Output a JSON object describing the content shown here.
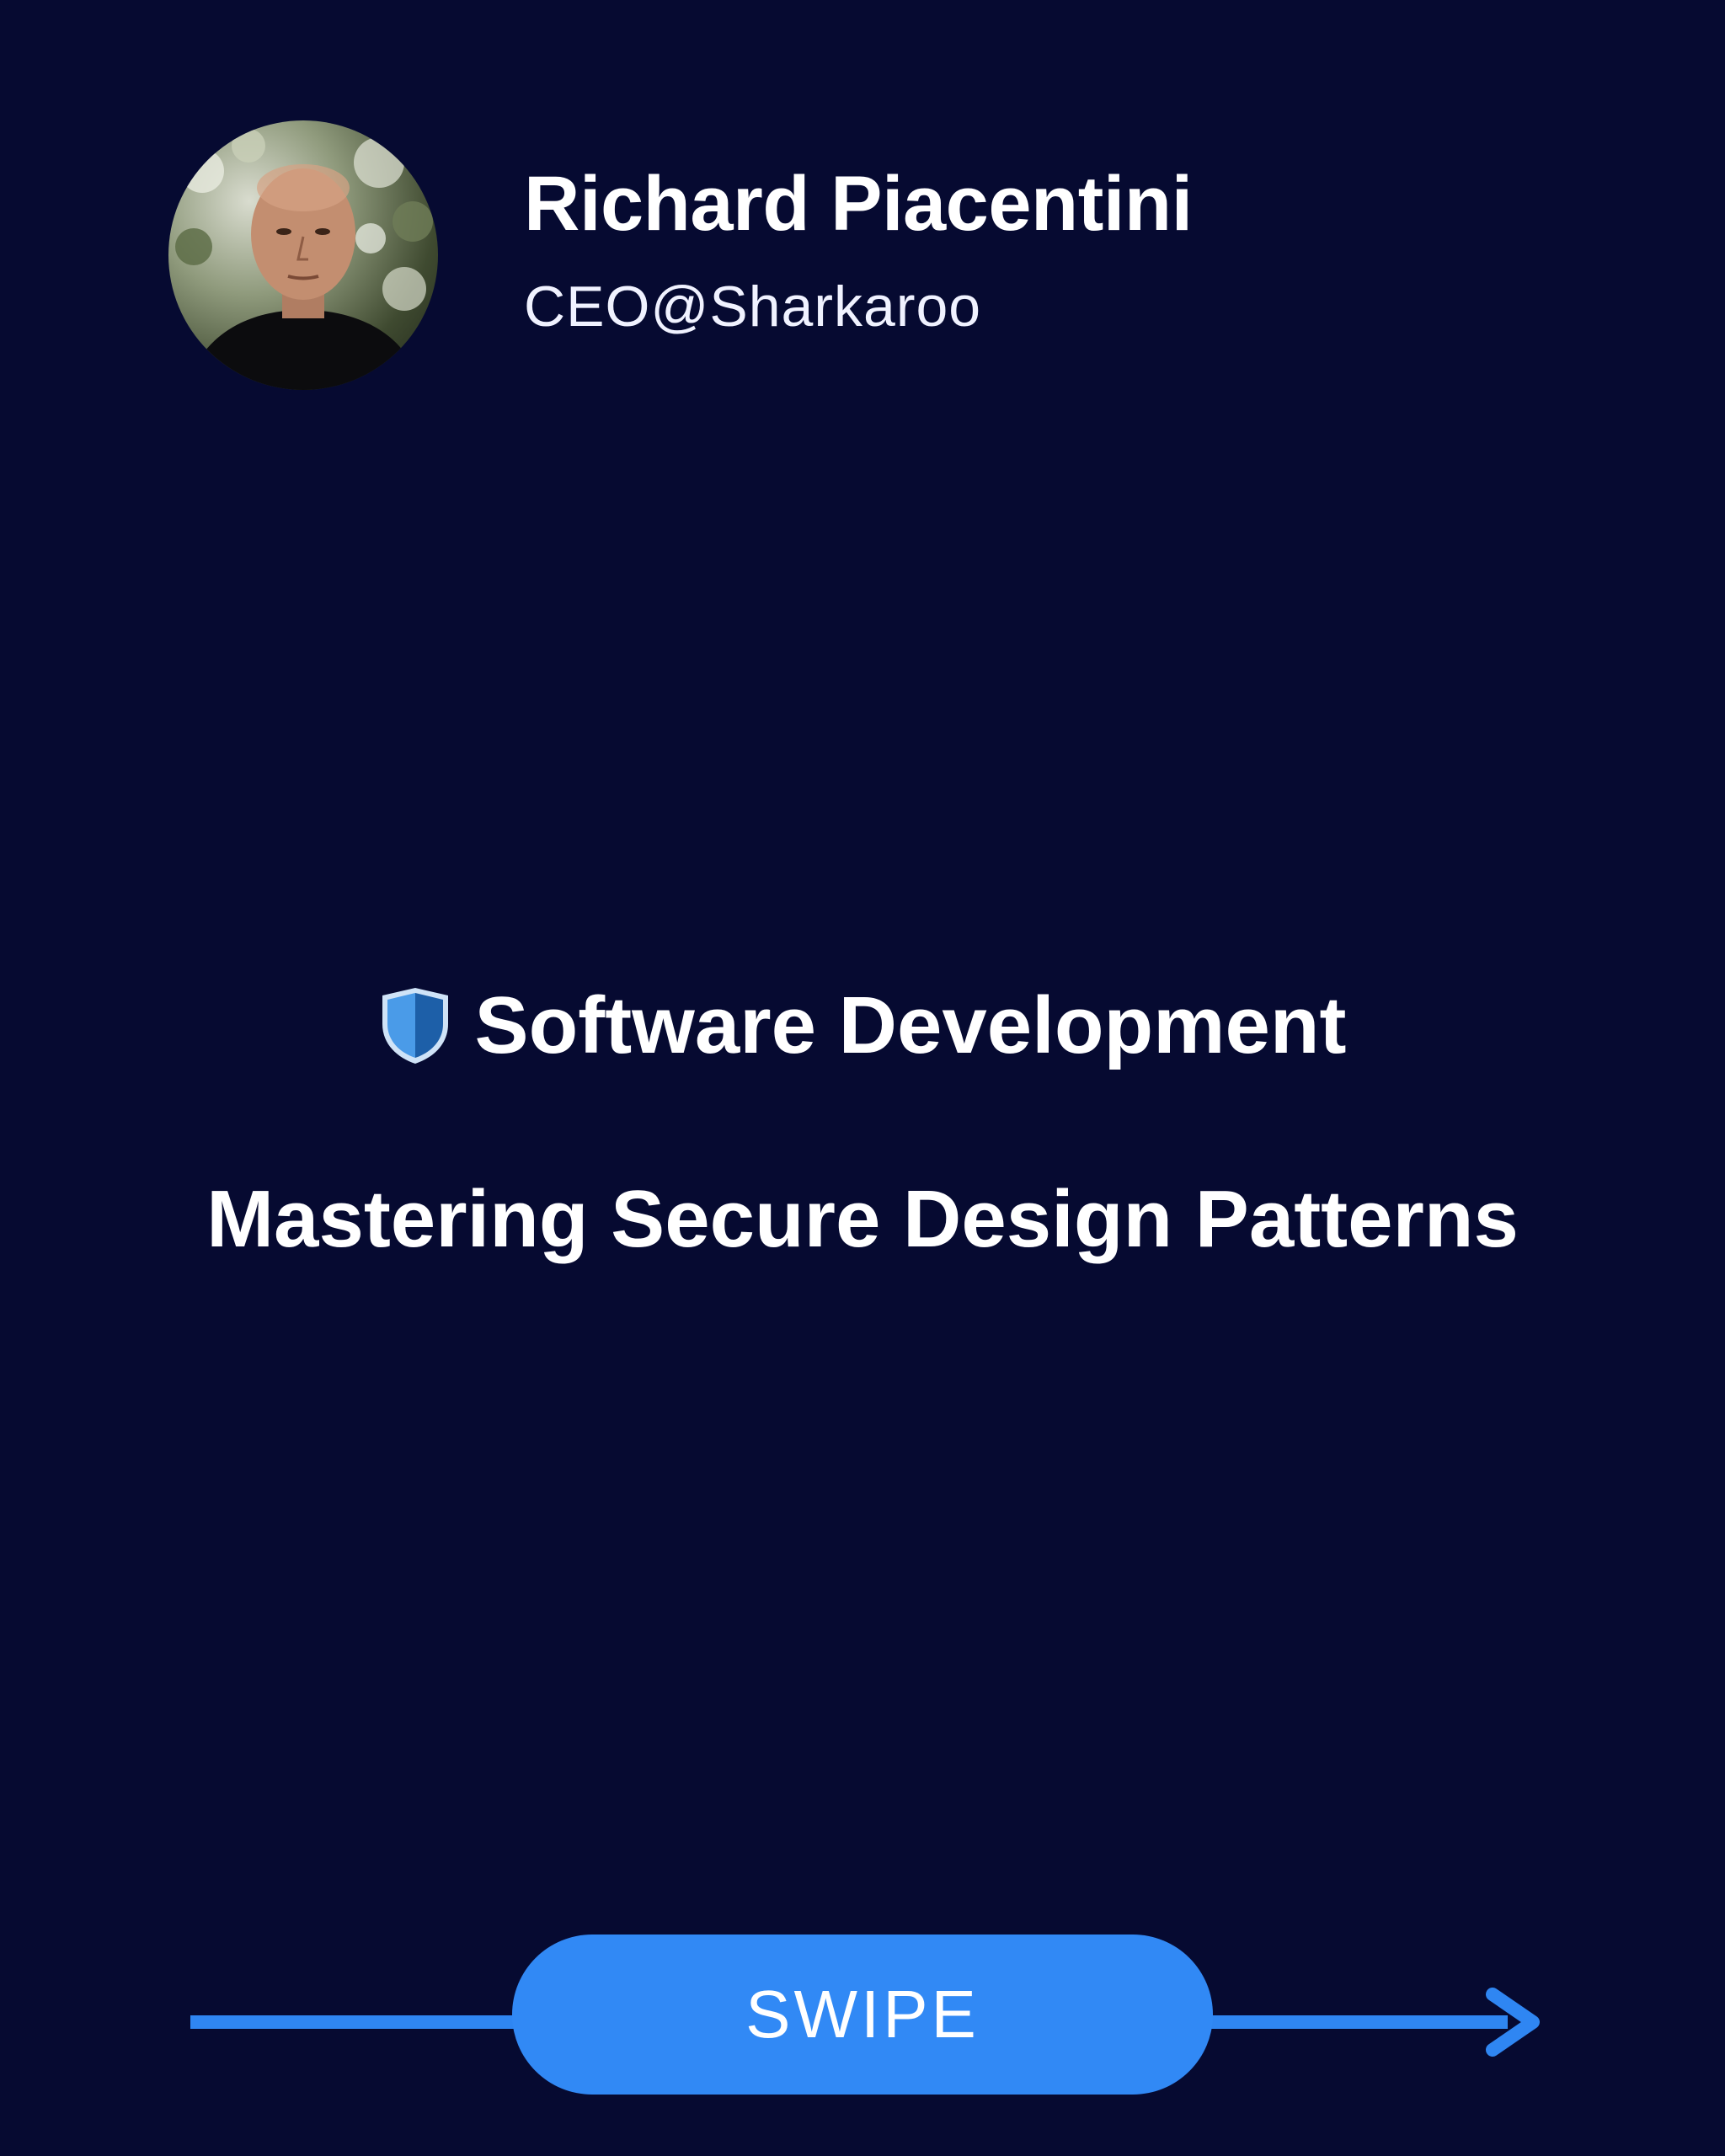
{
  "author": {
    "name": "Richard Piacentini",
    "role": "CEO@Sharkaroo",
    "avatar_icon": "profile-photo"
  },
  "content": {
    "category_icon": "shield-icon",
    "category": "Software Development",
    "title": "Mastering Secure Design Patterns"
  },
  "footer": {
    "swipe_label": "SWIPE",
    "arrow_icon": "arrow-right-icon"
  },
  "colors": {
    "background": "#060a31",
    "accent": "#3189f5",
    "text": "#ffffff"
  }
}
